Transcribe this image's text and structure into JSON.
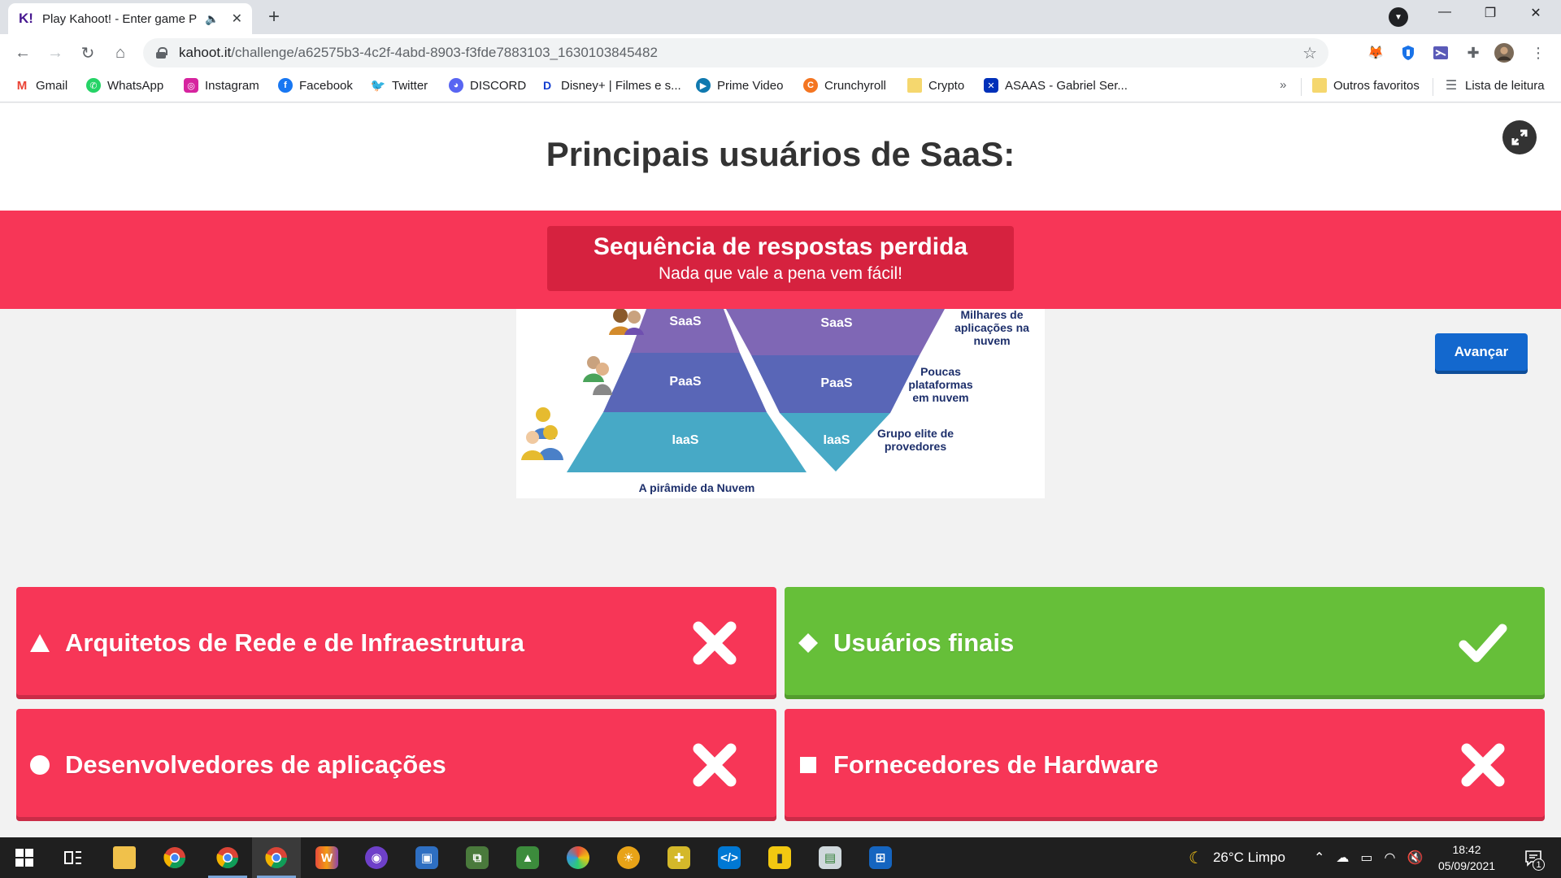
{
  "browser": {
    "tab_title": "Play Kahoot! - Enter game PIN",
    "tab_favicon": "K!",
    "url_host": "kahoot.it",
    "url_path": "/challenge/a62575b3-4c2f-4abd-8903-f3fde7883103_1630103845482",
    "bookmarks": [
      {
        "label": "Gmail",
        "icon": "gmail-icon",
        "color": "#ea4335"
      },
      {
        "label": "WhatsApp",
        "icon": "whatsapp-icon",
        "color": "#25d366"
      },
      {
        "label": "Instagram",
        "icon": "instagram-icon",
        "color": "#d6249f"
      },
      {
        "label": "Facebook",
        "icon": "facebook-icon",
        "color": "#1877f2"
      },
      {
        "label": "Twitter",
        "icon": "twitter-icon",
        "color": "#1da1f2"
      },
      {
        "label": "DISCORD",
        "icon": "discord-icon",
        "color": "#5865f2"
      },
      {
        "label": "Disney+ | Filmes e s...",
        "icon": "disney-icon",
        "color": "#113ccf"
      },
      {
        "label": "Prime Video",
        "icon": "prime-video-icon",
        "color": "#0f79af"
      },
      {
        "label": "Crunchyroll",
        "icon": "crunchyroll-icon",
        "color": "#f47521"
      },
      {
        "label": "Crypto",
        "icon": "folder-icon",
        "color": "#f5d76e"
      },
      {
        "label": "ASAAS - Gabriel Ser...",
        "icon": "asaas-icon",
        "color": "#0030b9"
      }
    ],
    "bookmarks_more": "»",
    "other_favorites": "Outros favoritos",
    "reading_list": "Lista de leitura"
  },
  "game": {
    "question": "Principais usuários de SaaS:",
    "streak_title": "Sequência de respostas perdida",
    "streak_subtitle": "Nada que vale a pena vem fácil!",
    "next_label": "Avançar",
    "image": {
      "left_layers": [
        "SaaS",
        "PaaS",
        "IaaS"
      ],
      "right_layers": [
        "SaaS",
        "PaaS",
        "IaaS"
      ],
      "right_notes": [
        [
          "Milhares de",
          "aplicações na",
          "nuvem"
        ],
        [
          "Poucas",
          "plataformas",
          "em nuvem"
        ],
        [
          "Grupo elite de",
          "provedores"
        ]
      ],
      "caption": "A pirâmide da Nuvem"
    },
    "answers": [
      {
        "text": "Arquitetos de Rede e de Infraestrutura",
        "shape": "triangle",
        "correct": false
      },
      {
        "text": "Usuários finais",
        "shape": "diamond",
        "correct": true
      },
      {
        "text": "Desenvolvedores de aplicações",
        "shape": "circle",
        "correct": false
      },
      {
        "text": "Fornecedores de Hardware",
        "shape": "square",
        "correct": false
      }
    ],
    "colors": {
      "wrong": "#f73657",
      "correct": "#66bf39",
      "banner": "#f73657",
      "banner_box": "#d6223f",
      "button": "#1368ce"
    }
  },
  "taskbar": {
    "weather": "26°C  Limpo",
    "time": "18:42",
    "date": "05/09/2021",
    "notifications": "1"
  }
}
